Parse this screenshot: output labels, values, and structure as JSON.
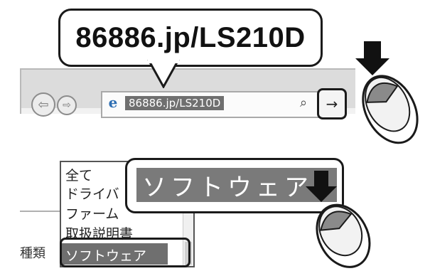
{
  "top": {
    "url_callout": "86886.jp/LS210D",
    "address_bar_text": "86886.jp/LS210D",
    "back_icon": "back-arrow-icon",
    "forward_icon": "forward-arrow-icon",
    "browser_icon": "ie-icon",
    "search_icon": "search-icon",
    "go_icon": "go-arrow-icon",
    "go_glyph": "→"
  },
  "bottom": {
    "field_label": "種類",
    "dropdown_items": [
      "全て",
      "ドライバ",
      "ファーム",
      "取扱説明書",
      "ソフトウェア"
    ],
    "selected_item": "ソフトウェア",
    "callout_text": "ソフトウェア"
  },
  "colors": {
    "highlight_gray": "#6f6f6f",
    "outline": "#1a1a1a"
  }
}
